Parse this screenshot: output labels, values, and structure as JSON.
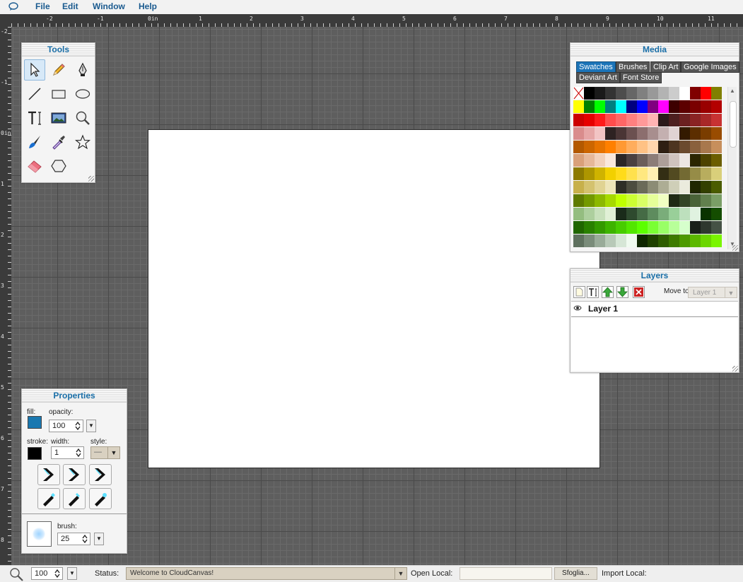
{
  "menu": {
    "items": [
      "File",
      "Edit",
      "Window",
      "Help"
    ],
    "logo_icon": "speech-bubble-icon"
  },
  "ruler": {
    "top_labels": [
      "-2",
      "-1",
      "0in",
      "1",
      "2",
      "3",
      "4",
      "5",
      "6",
      "7",
      "8",
      "9",
      "10",
      "11"
    ],
    "left_labels": [
      "-2",
      "-1",
      "0in",
      "1",
      "2",
      "3",
      "4",
      "5",
      "6",
      "7",
      "8"
    ]
  },
  "tools": {
    "title": "Tools",
    "items": [
      {
        "name": "select-tool",
        "icon": "arrow-cursor-icon",
        "selected": true
      },
      {
        "name": "pencil-tool",
        "icon": "pencil-icon"
      },
      {
        "name": "pen-tool",
        "icon": "pen-nib-icon"
      },
      {
        "name": "line-tool",
        "icon": "line-icon"
      },
      {
        "name": "rectangle-tool",
        "icon": "rectangle-icon"
      },
      {
        "name": "ellipse-tool",
        "icon": "ellipse-icon"
      },
      {
        "name": "text-tool",
        "icon": "text-cursor-icon"
      },
      {
        "name": "image-tool",
        "icon": "image-icon"
      },
      {
        "name": "zoom-tool",
        "icon": "magnifier-icon"
      },
      {
        "name": "brush-tool",
        "icon": "paintbrush-icon"
      },
      {
        "name": "eyedropper-tool",
        "icon": "eyedropper-icon"
      },
      {
        "name": "star-tool",
        "icon": "star-icon"
      },
      {
        "name": "eraser-tool",
        "icon": "eraser-icon"
      },
      {
        "name": "polygon-tool",
        "icon": "hexagon-icon"
      }
    ]
  },
  "media": {
    "title": "Media",
    "tabs": [
      "Swatches",
      "Brushes",
      "Clip Art",
      "Google Images",
      "Deviant Art",
      "Font Store"
    ],
    "active_tab": "Swatches",
    "swatch_rows": [
      [
        "none",
        "#000000",
        "#1a1a1a",
        "#333333",
        "#4d4d4d",
        "#666666",
        "#808080",
        "#999999",
        "#b3b3b3",
        "#cccccc",
        "#ffffff",
        "#800000",
        "#ff0000",
        "#808000"
      ],
      [
        "#ffff00",
        "#008000",
        "#00ff00",
        "#008080",
        "#00ffff",
        "#000080",
        "#0000ff",
        "#800080",
        "#ff00ff",
        "#3d0000",
        "#5c0000",
        "#7a0000",
        "#990000",
        "#b30000"
      ],
      [
        "#cc0000",
        "#e60000",
        "#ff1a1a",
        "#ff4d4d",
        "#ff6666",
        "#ff8080",
        "#ff9999",
        "#ffb3b3",
        "#2b1a1a",
        "#4d1f1f",
        "#6b2020",
        "#8a2323",
        "#a82828",
        "#c83232"
      ],
      [
        "#d98c8c",
        "#e6a6a6",
        "#f2c4c4",
        "#2e2222",
        "#4a3535",
        "#6b5050",
        "#8c6e6e",
        "#a88e8e",
        "#c4b0b0",
        "#e0d3d3",
        "#331a00",
        "#5c2e00",
        "#7a3d00",
        "#994c00"
      ],
      [
        "#b35900",
        "#cc6600",
        "#e67300",
        "#ff8000",
        "#ff9933",
        "#ffad5c",
        "#ffc285",
        "#ffd6ad",
        "#2e1f12",
        "#4d3520",
        "#6b4a2e",
        "#8a613d",
        "#a8784d",
        "#c78f5c"
      ],
      [
        "#d9a07a",
        "#e6b89a",
        "#f2d1bb",
        "#fae8dc",
        "#2b2626",
        "#4a4040",
        "#6b5e5a",
        "#8c7d78",
        "#ad9f99",
        "#cfc3be",
        "#ece6e3",
        "#2b2500",
        "#4d4300",
        "#6b5e00"
      ],
      [
        "#8c7a00",
        "#ad9600",
        "#cfb300",
        "#f2d000",
        "#ffdb1a",
        "#ffe14d",
        "#ffe880",
        "#fff0b3",
        "#332e14",
        "#524a21",
        "#736a33",
        "#968c47",
        "#b8ad5e",
        "#d9cf7a"
      ],
      [
        "#c7b04a",
        "#d4c26e",
        "#e0d392",
        "#ede5b8",
        "#2e2e26",
        "#4d4d3f",
        "#6b6b59",
        "#8c8c75",
        "#adad94",
        "#cfcfb8",
        "#ebebdd",
        "#1f2600",
        "#334000",
        "#4a5c00"
      ],
      [
        "#5e7a00",
        "#739900",
        "#8cb800",
        "#a6d900",
        "#c0ff00",
        "#ccff33",
        "#d9ff66",
        "#e6ff99",
        "#f0ffc2",
        "#1f2914",
        "#334526",
        "#4a6338",
        "#61804d",
        "#7a9e66"
      ],
      [
        "#94bd80",
        "#adcf9e",
        "#c7e0bb",
        "#e0f0d6",
        "#1a2b1a",
        "#2e4a2e",
        "#456b45",
        "#5e8c5e",
        "#7aad7a",
        "#99cf99",
        "#bde0bd",
        "#e0f2e0",
        "#0a3300",
        "#144d00"
      ],
      [
        "#1f6600",
        "#298000",
        "#339900",
        "#3db300",
        "#47cc00",
        "#52e600",
        "#5cff00",
        "#7aff33",
        "#99ff66",
        "#b8ff99",
        "#d6ffcc",
        "#1a1f1a",
        "#2e382e",
        "#455245"
      ],
      [
        "#5e705e",
        "#7a8c7a",
        "#99ab99",
        "#b8c9b8",
        "#d6e6d6",
        "#f0faf0",
        "#0f2600",
        "#1f4000",
        "#2e5c00",
        "#3d7a00",
        "#4d9900",
        "#5cb800",
        "#6bd600",
        "#7af500"
      ]
    ]
  },
  "layers": {
    "title": "Layers",
    "buttons": [
      {
        "name": "new-layer-button",
        "icon": "new-page-icon"
      },
      {
        "name": "rename-layer-button",
        "icon": "text-cursor-icon"
      },
      {
        "name": "layer-up-button",
        "icon": "up-arrow-icon"
      },
      {
        "name": "layer-down-button",
        "icon": "down-arrow-icon"
      },
      {
        "name": "delete-layer-button",
        "icon": "red-x-icon"
      }
    ],
    "move_to_label": "Move to:",
    "move_to_value": "Layer 1",
    "list": [
      {
        "name": "Layer 1",
        "visible": true
      }
    ]
  },
  "properties": {
    "title": "Properties",
    "fill_label": "fill:",
    "fill_color": "#1a78b0",
    "opacity_label": "opacity:",
    "opacity_value": "100",
    "stroke_label": "stroke:",
    "stroke_color": "#000000",
    "width_label": "width:",
    "width_value": "1",
    "style_label": "style:",
    "style_value": "—",
    "brush_label": "brush:",
    "brush_value": "25"
  },
  "status": {
    "zoom_value": "100",
    "status_label": "Status:",
    "status_text": "Welcome to CloudCanvas!",
    "open_local_label": "Open Local:",
    "browse_label": "Sfoglia...",
    "import_local_label": "Import Local:"
  },
  "colors": {
    "accent": "#1a6fa8",
    "active_tab": "#1c74b8",
    "workspace": "#5e5e5e"
  }
}
